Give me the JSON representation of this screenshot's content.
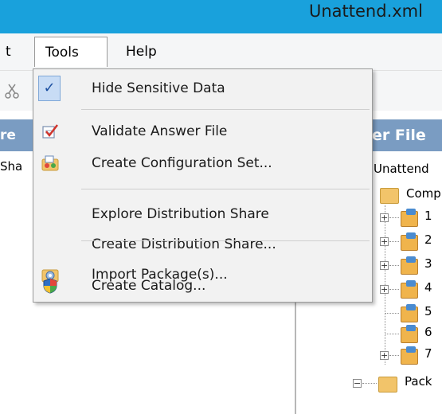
{
  "window": {
    "title": "Unattend.xml"
  },
  "menubar": {
    "items": [
      {
        "label": "t"
      },
      {
        "label": "Tools"
      },
      {
        "label": "Help"
      }
    ]
  },
  "left_pane": {
    "header": "re",
    "row": "Sha"
  },
  "right_pane": {
    "header": "er File",
    "tree": [
      {
        "label": "Unattend"
      },
      {
        "label": "Comp"
      },
      {
        "label": "1"
      },
      {
        "label": "2"
      },
      {
        "label": "3"
      },
      {
        "label": "4"
      },
      {
        "label": "5"
      },
      {
        "label": "6"
      },
      {
        "label": "7"
      },
      {
        "label": "Pack"
      }
    ]
  },
  "tools_menu": {
    "items": [
      {
        "label": "Hide Sensitive Data",
        "icon": "checkmark-icon",
        "checked": true
      },
      {
        "label": "Validate Answer File",
        "icon": "validate-icon"
      },
      {
        "label": "Create Configuration Set...",
        "icon": "configuration-set-icon"
      },
      {
        "label": "Explore Distribution Share",
        "icon": ""
      },
      {
        "label": "Create Distribution Share...",
        "icon": ""
      },
      {
        "label": "Import Package(s)...",
        "icon": "import-package-icon"
      },
      {
        "label": "Create Catalog...",
        "icon": "shield-icon"
      }
    ]
  },
  "colors": {
    "title_bar": "#19a1dc",
    "pane_header": "#7a9cc2",
    "menu_background": "#f2f2f2",
    "check_highlight": "#c8dcf5"
  }
}
